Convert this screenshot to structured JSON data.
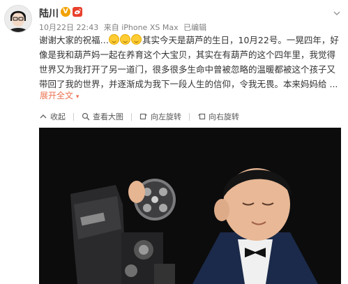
{
  "header": {
    "username": "陆川",
    "verified_badge": "V",
    "member_badge_icon": "weibo-member-icon",
    "avatar_icon": "avatar-portrait-icon",
    "date": "10月22日 22:43",
    "source": "来自 iPhone XS Max",
    "edited": "已编辑",
    "more_icon": "chevron-down-icon"
  },
  "post": {
    "text_before_emoji": "谢谢大家的祝福…",
    "emoji_names": [
      "laughing-emoji",
      "laughing-emoji",
      "laughing-emoji"
    ],
    "text_after_emoji": "其实今天是葫芦的生日，10月22号。一晃四年，好像是我和葫芦妈一起在养育这个大宝贝，其实在有葫芦的这个四年里，我觉得世界又为我打开了另一道门，很多很多生命中曾被忽略的温暖都被这个孩子又带回了我的世界，并逐渐成为我下一段人生的信仰，令我无畏。本来妈妈给 ...",
    "expand_label": "展开全文",
    "expand_icon": "chevron-down-icon"
  },
  "toolbar": {
    "collapse_label": "收起",
    "view_large_label": "查看大图",
    "rotate_left_label": "向左旋转",
    "rotate_right_label": "向右旋转"
  },
  "colors": {
    "accent": "#eb7350",
    "verified": "#f2a100",
    "member": "#e8402b",
    "photo_bg": "#0c0c0d"
  }
}
